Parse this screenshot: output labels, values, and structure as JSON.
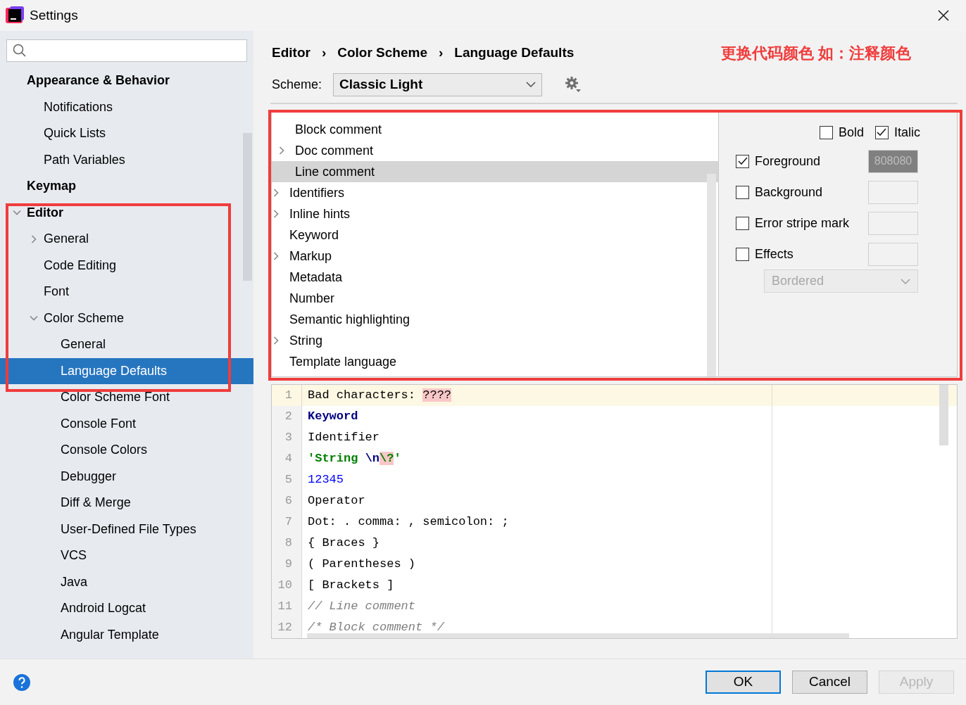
{
  "window": {
    "title": "Settings"
  },
  "sidebar": {
    "items": [
      {
        "label": "Appearance & Behavior",
        "bold": true,
        "selected": false,
        "children": [
          {
            "label": "Notifications",
            "selected": false
          },
          {
            "label": "Quick Lists",
            "selected": false
          },
          {
            "label": "Path Variables",
            "selected": false
          }
        ]
      },
      {
        "label": "Keymap",
        "bold": true,
        "selected": false
      },
      {
        "label": "Editor",
        "bold": true,
        "selected": false,
        "expanded": true,
        "children": [
          {
            "label": "General",
            "selected": false,
            "expanded": false
          },
          {
            "label": "Code Editing",
            "selected": false
          },
          {
            "label": "Font",
            "selected": false
          },
          {
            "label": "Color Scheme",
            "selected": false,
            "expanded": true,
            "children": [
              {
                "label": "General",
                "selected": false
              },
              {
                "label": "Language Defaults",
                "selected": true
              },
              {
                "label": "Color Scheme Font",
                "selected": false
              },
              {
                "label": "Console Font",
                "selected": false
              },
              {
                "label": "Console Colors",
                "selected": false
              },
              {
                "label": "Debugger",
                "selected": false
              },
              {
                "label": "Diff & Merge",
                "selected": false
              },
              {
                "label": "User-Defined File Types",
                "selected": false
              },
              {
                "label": "VCS",
                "selected": false
              },
              {
                "label": "Java",
                "selected": false
              },
              {
                "label": "Android Logcat",
                "selected": false
              },
              {
                "label": "Angular Template",
                "selected": false
              }
            ]
          }
        ]
      }
    ]
  },
  "breadcrumb": [
    "Editor",
    "Color Scheme",
    "Language Defaults"
  ],
  "breadcrumb_separator": "›",
  "annotation": {
    "text": "更换代码颜色 如：注释颜色",
    "color": "#f03c3c"
  },
  "scheme": {
    "label": "Scheme:",
    "value": "Classic Light"
  },
  "attributes": [
    {
      "children": [
        {
          "label": "Block comment",
          "selected": false
        },
        {
          "label": "Doc comment",
          "selected": false,
          "expanded": false
        },
        {
          "label": "Line comment",
          "selected": true
        }
      ]
    },
    {
      "label": "Identifiers",
      "selected": false,
      "expanded": false
    },
    {
      "label": "Inline hints",
      "selected": false,
      "expanded": false
    },
    {
      "label": "Keyword",
      "selected": false
    },
    {
      "label": "Markup",
      "selected": false,
      "expanded": false
    },
    {
      "label": "Metadata",
      "selected": false
    },
    {
      "label": "Number",
      "selected": false
    },
    {
      "label": "Semantic highlighting",
      "selected": false
    },
    {
      "label": "String",
      "selected": false,
      "expanded": false
    },
    {
      "label": "Template language",
      "selected": false
    }
  ],
  "font_style": [
    {
      "label": "Bold",
      "checked": false
    },
    {
      "label": "Italic",
      "checked": true
    }
  ],
  "color_options": [
    {
      "label": "Foreground",
      "checked": true,
      "swatch": {
        "value": "808080",
        "color": "#808080"
      }
    },
    {
      "label": "Background",
      "checked": false
    },
    {
      "label": "Error stripe mark",
      "checked": false
    },
    {
      "label": "Effects",
      "checked": false
    }
  ],
  "effect_type": {
    "value": "Bordered",
    "disabled": true
  },
  "preview": {
    "lines": [
      {
        "number": "1",
        "current": true,
        "segments": [
          {
            "kind": "plain",
            "text": "Bad characters: "
          },
          {
            "kind": "bad",
            "text": "????"
          }
        ]
      },
      {
        "number": "2",
        "current": false,
        "segments": [
          {
            "kind": "keyword",
            "text": "Keyword"
          }
        ]
      },
      {
        "number": "3",
        "current": false,
        "segments": [
          {
            "kind": "plain",
            "text": "Identifier"
          }
        ]
      },
      {
        "number": "4",
        "current": false,
        "segments": [
          {
            "kind": "string",
            "text": "'String "
          },
          {
            "kind": "escape",
            "text": "\\n"
          },
          {
            "kind": "badstring",
            "text": "\\?"
          },
          {
            "kind": "string",
            "text": "'"
          }
        ]
      },
      {
        "number": "5",
        "current": false,
        "segments": [
          {
            "kind": "number",
            "text": "12345"
          }
        ]
      },
      {
        "number": "6",
        "current": false,
        "segments": [
          {
            "kind": "plain",
            "text": "Operator"
          }
        ]
      },
      {
        "number": "7",
        "current": false,
        "segments": [
          {
            "kind": "plain",
            "text": "Dot: . comma: , semicolon: ;"
          }
        ]
      },
      {
        "number": "8",
        "current": false,
        "segments": [
          {
            "kind": "plain",
            "text": "{ Braces }"
          }
        ]
      },
      {
        "number": "9",
        "current": false,
        "segments": [
          {
            "kind": "plain",
            "text": "( Parentheses )"
          }
        ]
      },
      {
        "number": "10",
        "current": false,
        "segments": [
          {
            "kind": "plain",
            "text": "[ Brackets ]"
          }
        ]
      },
      {
        "number": "11",
        "current": false,
        "segments": [
          {
            "kind": "comment",
            "text": "// Line comment"
          }
        ]
      },
      {
        "number": "12",
        "current": false,
        "segments": [
          {
            "kind": "comment",
            "text": "/* Block comment */"
          }
        ]
      }
    ]
  },
  "buttons": [
    {
      "label": "OK",
      "kind": "default",
      "disabled": false
    },
    {
      "label": "Cancel",
      "kind": "normal",
      "disabled": false
    },
    {
      "label": "Apply",
      "kind": "normal",
      "disabled": true
    }
  ]
}
